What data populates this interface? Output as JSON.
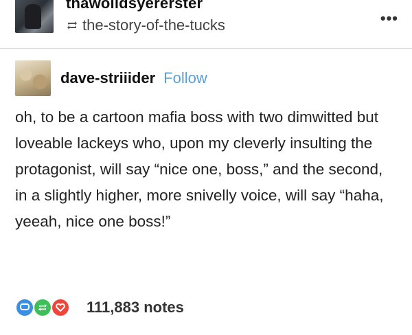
{
  "header": {
    "reblogger_username": "thawolldsyererster",
    "reblog_source": "the-story-of-the-tucks",
    "more_label": "•••"
  },
  "post": {
    "username": "dave-striiider",
    "follow_label": "Follow",
    "body": "oh, to be a cartoon mafia boss with two dimwitted but loveable lackeys who, upon my cleverly insulting the protagonist, will say “nice one, boss,” and the second, in a slightly higher, more snivelly voice, will say “haha, yeeah, nice one boss!”"
  },
  "footer": {
    "notes_count": "111,883 notes"
  },
  "colors": {
    "follow_link": "#5aa0d6",
    "reply_bubble": "#3b8fe0",
    "reblog_bubble": "#3fbf5a",
    "like_bubble": "#f0453a"
  },
  "icons": [
    "reblog-icon",
    "more-icon",
    "reply-icon",
    "reblog-bubble-icon",
    "heart-icon"
  ]
}
